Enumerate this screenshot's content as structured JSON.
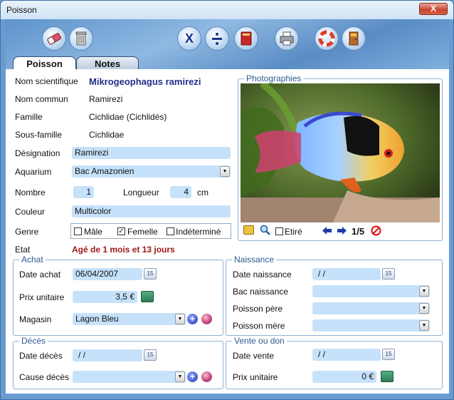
{
  "window": {
    "title": "Poisson",
    "close_label": "X"
  },
  "tabs": [
    {
      "label": "Poisson"
    },
    {
      "label": "Notes"
    }
  ],
  "details": {
    "nom_scientifique_label": "Nom scientifique",
    "nom_scientifique": "Mikrogeophagus ramirezi",
    "nom_commun_label": "Nom commun",
    "nom_commun": "Ramirezi",
    "famille_label": "Famille",
    "famille": "Cichlidae (Cichlidés)",
    "sous_famille_label": "Sous-famille",
    "sous_famille": "Cichlidae",
    "designation_label": "Désignation",
    "designation": "Ramirezi",
    "aquarium_label": "Aquarium",
    "aquarium": "Bac Amazonien",
    "nombre_label": "Nombre",
    "nombre": "1",
    "longueur_label": "Longueur",
    "longueur": "4",
    "longueur_unit": "cm",
    "couleur_label": "Couleur",
    "couleur": "Multicolor",
    "genre_label": "Genre",
    "genre_options": [
      {
        "label": "Mâle",
        "checked": false
      },
      {
        "label": "Femelle",
        "checked": true
      },
      {
        "label": "Indéterminé",
        "checked": false
      }
    ],
    "etat_label": "Etat",
    "etat": "Agé de 1 mois et 13 jours"
  },
  "photos": {
    "title": "Photographies",
    "etire_label": "Etiré",
    "counter": "1/5"
  },
  "achat": {
    "title": "Achat",
    "date_label": "Date achat",
    "date": "06/04/2007",
    "prix_label": "Prix unitaire",
    "prix": "3,5 €",
    "magasin_label": "Magasin",
    "magasin": "Lagon Bleu"
  },
  "naissance": {
    "title": "Naissance",
    "date_label": "Date naissance",
    "date": "/ /",
    "bac_label": "Bac naissance",
    "pere_label": "Poisson père",
    "mere_label": "Poisson mère"
  },
  "deces": {
    "title": "Décès",
    "date_label": "Date décès",
    "date": "/ /",
    "cause_label": "Cause décès"
  },
  "vente": {
    "title": "Vente ou don",
    "date_label": "Date vente",
    "date": "/ /",
    "prix_label": "Prix unitaire",
    "prix": "0 €"
  },
  "cal_label": "15",
  "icons": [
    "eraser-icon",
    "trash-icon",
    "cancel-x-icon",
    "divide-icon",
    "book-icon",
    "printer-icon",
    "lifebuoy-help-icon",
    "exit-door-icon",
    "folder-icon",
    "magnifier-icon",
    "arrow-left-icon",
    "arrow-right-icon",
    "delete-icon",
    "calendar-icon",
    "calculator-icon",
    "add-icon",
    "edit-icon"
  ],
  "colors": {
    "accent": "#1f2f8a",
    "etat": "#a01818",
    "field": "#c6e2fb",
    "group_title": "#2c5c91"
  }
}
